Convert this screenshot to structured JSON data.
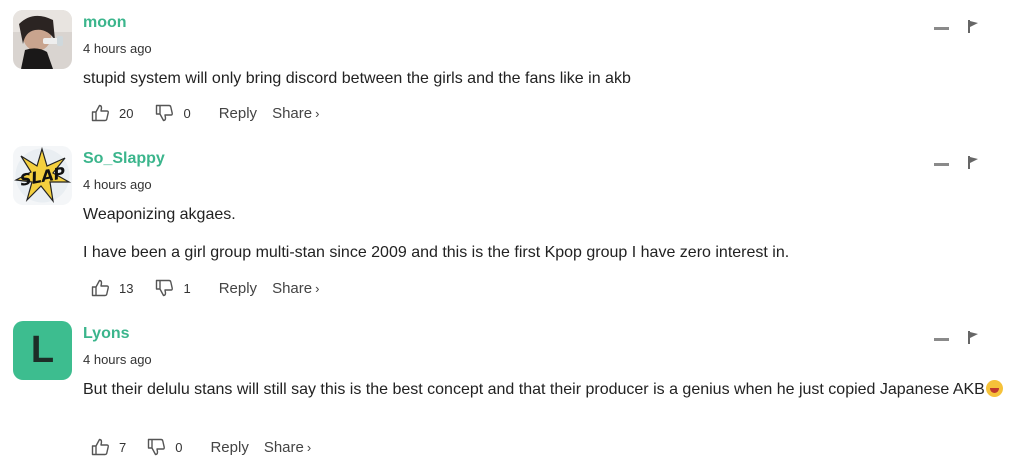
{
  "comments": [
    {
      "username": "moon",
      "timestamp": "4 hours ago",
      "avatar_icon": "user-photo-avatar",
      "paragraphs": [
        "stupid system will only bring discord between the girls and the fans like in akb"
      ],
      "likes": "20",
      "dislikes": "0",
      "reply_label": "Reply",
      "share_label": "Share",
      "share_chevron": "›"
    },
    {
      "username": "So_Slappy",
      "timestamp": "4 hours ago",
      "avatar_icon": "slap-comic-avatar",
      "avatar_text": "SLAP",
      "paragraphs": [
        "Weaponizing akgaes.",
        "I have been a girl group multi-stan since 2009 and this is the first Kpop group I have zero interest in."
      ],
      "likes": "13",
      "dislikes": "1",
      "reply_label": "Reply",
      "share_label": "Share",
      "share_chevron": "›"
    },
    {
      "username": "Lyons",
      "timestamp": "4 hours ago",
      "avatar_letter": "L",
      "paragraphs": [
        "But their delulu stans will still say this is the best concept and that their producer is a genius when he just copied Japanese AKB"
      ],
      "emoji_icon": "laughing-emoji",
      "likes": "7",
      "dislikes": "0",
      "reply_label": "Reply",
      "share_label": "Share",
      "share_chevron": "›"
    }
  ],
  "colors": {
    "username": "#3bb58c",
    "letter_avatar_bg": "#3dbd8f",
    "text": "#222222",
    "muted": "#444444"
  }
}
